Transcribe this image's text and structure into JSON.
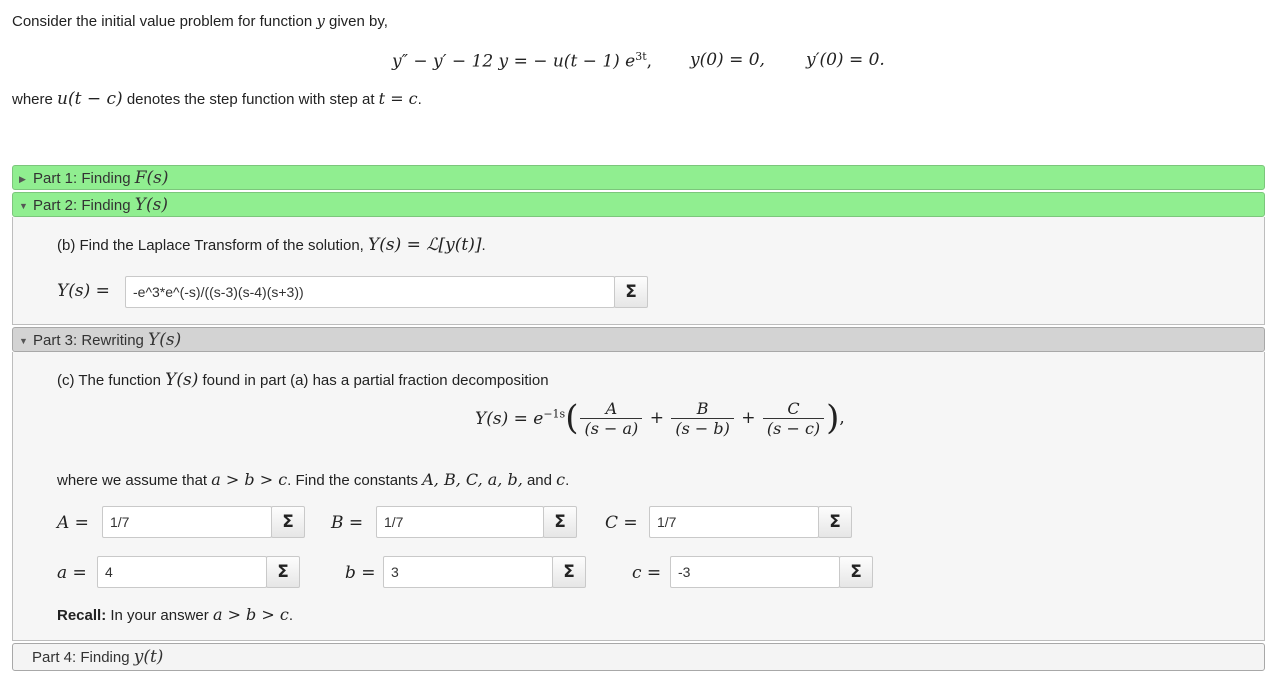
{
  "problem": {
    "intro": "Consider the initial value problem for function",
    "intro_var": "y",
    "intro_end": "given by,",
    "ode": "y″ − y′ − 12 y = − u(t − 1) e",
    "ode_exp": "3t",
    "ode_comma": ",",
    "ic1": "y(0) = 0,",
    "ic2": "y′(0) = 0.",
    "where_pre": "where",
    "where_math": "u(t − c)",
    "where_mid": "denotes the step function with step at",
    "where_math2": "t = c",
    "where_end": "."
  },
  "part1": {
    "label": "Part 1: Finding",
    "math": "F(s)"
  },
  "part2": {
    "label": "Part 2: Finding",
    "math": "Y(s)",
    "question_pre": "(b) Find the Laplace Transform of the solution,",
    "question_math": "Y(s) = ℒ[y(t)]",
    "question_end": ".",
    "input_label": "Y(s) =",
    "input_value": "-e^3*e^(-s)/((s-3)(s-4)(s+3))",
    "sigma": "Σ"
  },
  "part3": {
    "label": "Part 3: Rewriting",
    "math": "Y(s)",
    "q_pre": "(c) The function",
    "q_math": "Y(s)",
    "q_end": "found in part (a) has a partial fraction decomposition",
    "decomp_lhs": "Y(s) = e",
    "decomp_exp": "−1s",
    "frac_A_num": "A",
    "frac_A_den": "(s − a)",
    "frac_B_num": "B",
    "frac_B_den": "(s − b)",
    "frac_C_num": "C",
    "frac_C_den": "(s − c)",
    "plus": "+",
    "assume_pre": "where we assume that",
    "assume_math": "a > b > c",
    "assume_mid": ". Find the constants",
    "assume_consts": "A, B, C, a, b,",
    "assume_and": "and",
    "assume_c": "c",
    "assume_end": ".",
    "A_label": "A =",
    "A_value": "1/7",
    "B_label": "B =",
    "B_value": "1/7",
    "C_label": "C =",
    "C_value": "1/7",
    "a_label": "a =",
    "a_value": "4",
    "b_label": "b =",
    "b_value": "3",
    "c_label": "c =",
    "c_value": "-3",
    "recall_bold": "Recall:",
    "recall_text": "In your answer",
    "recall_math": "a > b > c",
    "recall_end": ".",
    "sigma": "Σ"
  },
  "part4": {
    "label": "Part 4: Finding",
    "math": "y(t)"
  },
  "colors": {
    "completed_part": "#90ee90",
    "active_part": "#d3d3d3"
  }
}
